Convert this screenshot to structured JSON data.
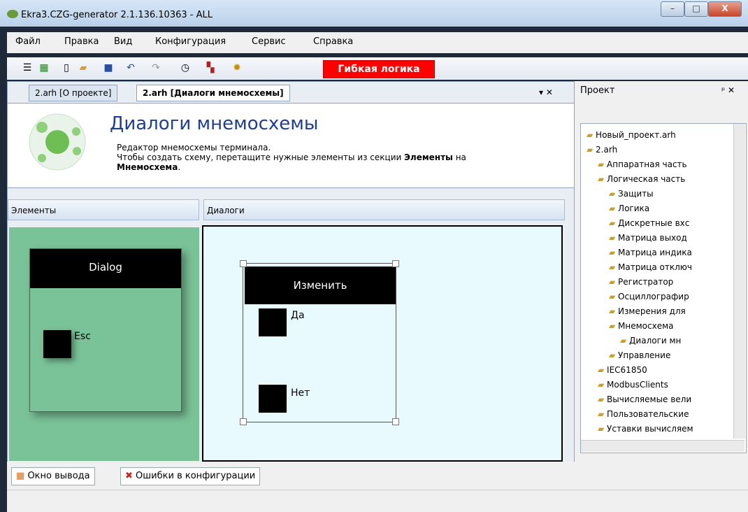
{
  "window": {
    "title": "Ekra3.CZG-generator 2.1.136.10363 - ALL",
    "minimize": "–",
    "maximize": "□",
    "close": "X"
  },
  "menu": [
    "Файл",
    "Правка",
    "Вид",
    "Конфигурация",
    "Сервис",
    "Справка"
  ],
  "toolbar": {
    "flexible_logic": "Гибкая логика"
  },
  "tabs": {
    "tab1": "2.arh [О проекте]",
    "tab2": "2.arh [Диалоги мнемосхемы]",
    "close": "▾ ✕"
  },
  "header": {
    "title": "Диалоги мнемосхемы",
    "line1": "Редактор мнемосхемы терминала.",
    "line2_prefix": "Чтобы создать схему, перетащите нужные элементы из секции ",
    "line2_bold": "Элементы",
    "line2_suffix": " на",
    "line3_bold": "Мнемосхема",
    "line3_suffix": "."
  },
  "elements_panel": {
    "title": "Элементы",
    "dialog_label": "Dialog",
    "esc_label": "Esc"
  },
  "dialogs_panel": {
    "title": "Диалоги",
    "dialog_title": "Изменить",
    "yes": "Да",
    "no": "Нет"
  },
  "project_panel": {
    "title": "Проект",
    "pin": "ᵖ ✕",
    "tree": [
      {
        "label": "Новый_проект.arh",
        "indent": 0
      },
      {
        "label": "2.arh",
        "indent": 0
      },
      {
        "label": "Аппаратная часть",
        "indent": 1
      },
      {
        "label": "Логическая часть",
        "indent": 1
      },
      {
        "label": "Защиты",
        "indent": 2
      },
      {
        "label": "Логика",
        "indent": 2
      },
      {
        "label": "Дискретные вхс",
        "indent": 2
      },
      {
        "label": "Матрица выход",
        "indent": 2
      },
      {
        "label": "Матрица индика",
        "indent": 2
      },
      {
        "label": "Матрица отключ",
        "indent": 2
      },
      {
        "label": "Регистратор",
        "indent": 2
      },
      {
        "label": "Осциллографир",
        "indent": 2
      },
      {
        "label": "Измерения для",
        "indent": 2
      },
      {
        "label": "Мнемосхема",
        "indent": 2
      },
      {
        "label": "Диалоги мн",
        "indent": 3
      },
      {
        "label": "Управление",
        "indent": 2
      },
      {
        "label": "IEC61850",
        "indent": 1
      },
      {
        "label": "ModbusClients",
        "indent": 1
      },
      {
        "label": "Вычисляемые вели",
        "indent": 1
      },
      {
        "label": "Пользовательские",
        "indent": 1
      },
      {
        "label": "Уставки вычисляем",
        "indent": 1
      }
    ]
  },
  "bottom_tabs": {
    "output": "Окно вывода",
    "errors": "Ошибки в конфигурации"
  }
}
